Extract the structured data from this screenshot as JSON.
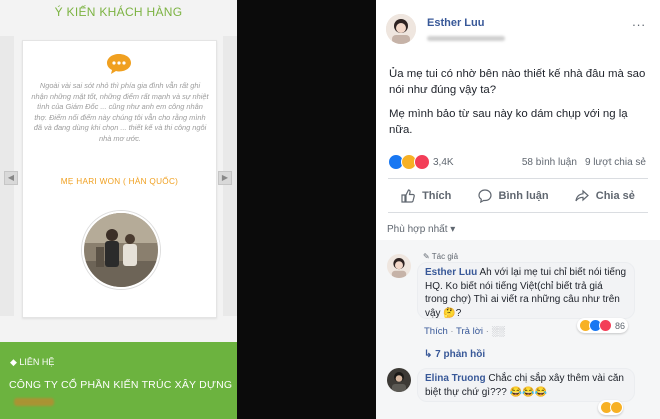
{
  "website": {
    "section_title": "Ý KIẾN KHÁCH HÀNG",
    "review_text": "Ngoài vài sai sót nhỏ thì phía gia đình vẫn rất ghi nhận những mặt tốt, những điểm rất mạnh và sự nhiệt tình của Giám Đốc ... cũng như anh em công nhân thợ. Điểm nổi điểm này chúng tôi vẫn cho rằng mình đã và đang dùng khi chọn ... thiết kế và thi công ngôi nhà mơ ước.",
    "reviewer": "MẸ HARI WON ( HÀN QUỐC)",
    "footer_contact": "LIÊN HỆ",
    "footer_company": "CÔNG TY CỔ PHẦN KIẾN TRÚC XÂY DỰNG",
    "colors": {
      "green": "#6cb33f",
      "orange": "#f0a020"
    }
  },
  "post": {
    "author": "Esther Luu",
    "menu": "...",
    "text1": "Ủa mẹ tui có nhờ bên nào thiết kế nhà đâu mà sao nói như đúng vậy ta?",
    "text2": "Mẹ mình bảo từ sau này ko dám chụp với ng lạ nữa.",
    "reactions_count": "3,4K",
    "comments_count": "58 bình luận",
    "shares_count": "9 lượt chia sẻ",
    "actions": {
      "like": "Thích",
      "comment": "Bình luận",
      "share": "Chia sẻ"
    },
    "sort_label": "Phù hợp nhất ▾"
  },
  "comments": [
    {
      "tag": "Tác giả",
      "author": "Esther Luu",
      "text": "Ah với lại mẹ tui chỉ biết nói tiếng HQ. Ko biết nói tiếng Việt(chỉ biết trả giá trong chợ) Thì ai viết ra những câu như trên vậy 🤔?",
      "like": "Thích",
      "reply": "Trả lời",
      "reaction_count": "86"
    },
    {
      "author": "Elina Truong",
      "text": "Chắc chị sắp xây thêm vài căn biệt thự chứ gì??? 😂😂😂"
    }
  ],
  "replies_label": "7 phản hồi"
}
